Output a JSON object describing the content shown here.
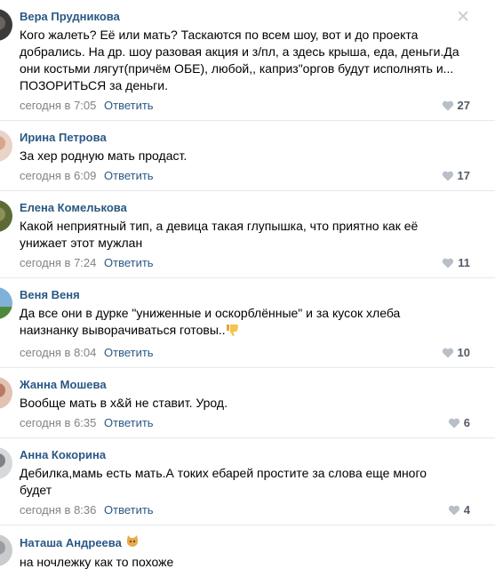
{
  "comments": [
    {
      "author": "Вера Прудникова",
      "text": "Кого жалеть? Её или мать? Таскаются по всем шоу, вот и до проекта добрались. На др. шоу разовая акция и з/пл, а здесь крыша, еда, деньги.Да они костьми лягут(причём ОБЕ), любой,, каприз\"оргов будут исполнять и... ПОЗОРИТЬСЯ за деньги.",
      "time": "сегодня в 7:05",
      "reply": "Ответить",
      "likes": "27",
      "avatar_color": "#3c3a38"
    },
    {
      "author": "Ирина Петрова",
      "text": "За хер родную мать продаст.",
      "time": "сегодня в 6:09",
      "reply": "Ответить",
      "likes": "17",
      "avatar_color": "#d9b7a5"
    },
    {
      "author": "Елена Комелькова",
      "text": "Какой неприятный тип, а девица такая глупышка, что приятно как её унижает этот мужлан",
      "time": "сегодня в 7:24",
      "reply": "Ответить",
      "likes": "11",
      "avatar_color": "#6f7b3c"
    },
    {
      "author": "Веня Веня",
      "text": "Да все они в дурке \"униженные и оскорблённые\" и за кусок хлеба наизнанку выворачиваться готовы..",
      "time": "сегодня в 8:04",
      "reply": "Ответить",
      "likes": "10",
      "avatar_color": "#5b8fb8"
    },
    {
      "author": "Жанна Мошева",
      "text": "Вообще мать в х&й не ставит. Урод.",
      "time": "сегодня в 6:35",
      "reply": "Ответить",
      "likes": "6",
      "avatar_color": "#c08d78"
    },
    {
      "author": "Анна Кокорина",
      "text": "Дебилка,мамь есть мать.А токих ебарей простите за слова еще много будет",
      "time": "сегодня в 8:36",
      "reply": "Ответить",
      "likes": "4",
      "avatar_color": "#8a8d90"
    },
    {
      "author": "Наташа Андреева",
      "text": "на ночлежку как то похоже",
      "avatar_color": "#b0b2b4"
    }
  ],
  "icons": {
    "close": "close-icon",
    "like": "heart-icon",
    "thumbs_down": "thumbs-down-emoji-icon",
    "cat": "cat-emoji-icon"
  },
  "colors": {
    "link": "#2a5885",
    "meta": "#828282",
    "likes": "#545b66",
    "divider": "#e7e8ec"
  }
}
